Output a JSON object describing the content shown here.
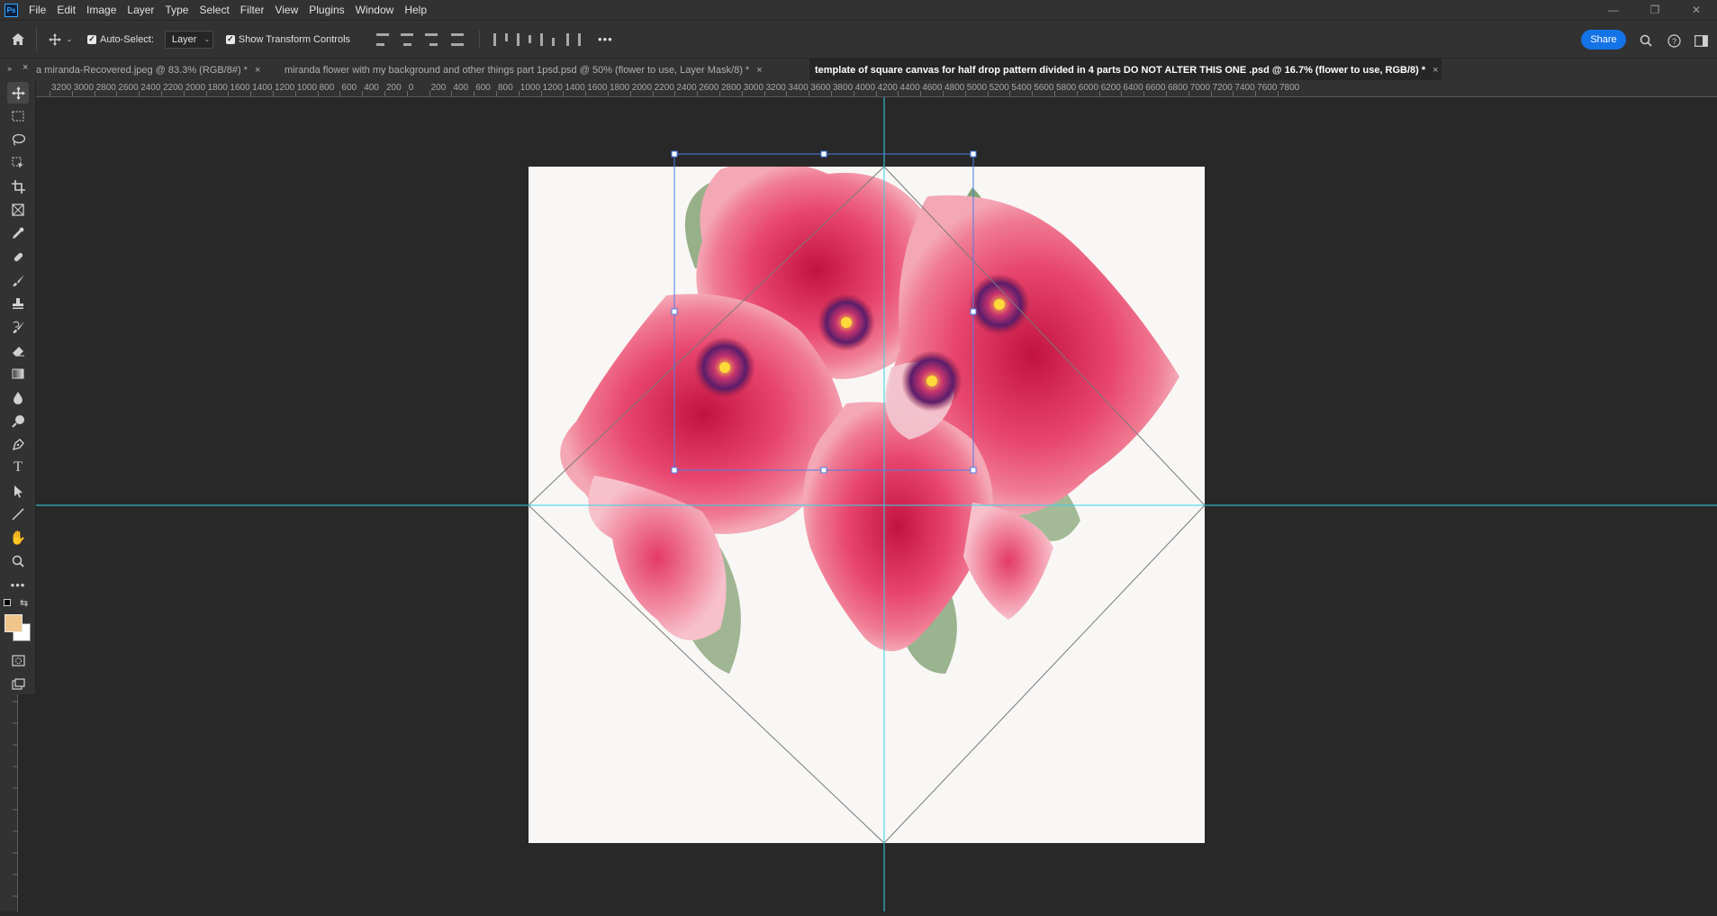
{
  "app": {
    "logo": "Ps"
  },
  "menu": [
    "File",
    "Edit",
    "Image",
    "Layer",
    "Type",
    "Select",
    "Filter",
    "View",
    "Plugins",
    "Window",
    "Help"
  ],
  "window_controls": {
    "minimize": "—",
    "restore": "❐",
    "close": "✕"
  },
  "options": {
    "auto_select_label": "Auto-Select:",
    "auto_select_checked": true,
    "layer_select_value": "Layer",
    "transform_controls_label": "Show Transform Controls",
    "transform_controls_checked": true,
    "more": "•••",
    "share_label": "Share"
  },
  "tabs": [
    {
      "label": "a miranda-Recovered.jpeg @ 83.3% (RGB/8#) *",
      "active": false
    },
    {
      "label": "miranda flower with my background and other things part 1psd.psd @ 50% (flower to use, Layer Mask/8) *",
      "active": false
    },
    {
      "label": "template of square canvas for half drop pattern divided in 4 parts DO NOT ALTER THIS ONE .psd @ 16.7% (flower to use, RGB/8) *",
      "active": true
    }
  ],
  "ruler_labels": [
    "3200",
    "3000",
    "2800",
    "2600",
    "2400",
    "2200",
    "2000",
    "1800",
    "1600",
    "1400",
    "1200",
    "1000",
    "800",
    "600",
    "400",
    "200",
    "0",
    "200",
    "400",
    "600",
    "800",
    "1000",
    "1200",
    "1400",
    "1600",
    "1800",
    "2000",
    "2200",
    "2400",
    "2600",
    "2800",
    "3000",
    "3200",
    "3400",
    "3600",
    "3800",
    "4000",
    "4200",
    "4400",
    "4600",
    "4800",
    "5000",
    "5200",
    "5400",
    "5600",
    "5800",
    "6000",
    "6200",
    "6400",
    "6600",
    "6800",
    "7000",
    "7200",
    "7400",
    "7600",
    "7800"
  ],
  "tools": [
    "move-tool",
    "marquee-tool",
    "lasso-tool",
    "object-select-tool",
    "crop-tool",
    "frame-tool",
    "eyedropper-tool",
    "healing-brush-tool",
    "brush-tool",
    "stamp-tool",
    "history-brush-tool",
    "eraser-tool",
    "gradient-tool",
    "blur-tool",
    "dodge-tool",
    "pen-tool",
    "type-tool",
    "path-select-tool",
    "line-tool",
    "hand-tool",
    "zoom-tool",
    "more-tools"
  ],
  "colors": {
    "foreground": "#f0c48a",
    "background": "#ffffff",
    "guide": "#33d6e8",
    "transform_box": "#4a7ee8",
    "canvas": "#f8f7f5",
    "accent": "#1473e6"
  }
}
